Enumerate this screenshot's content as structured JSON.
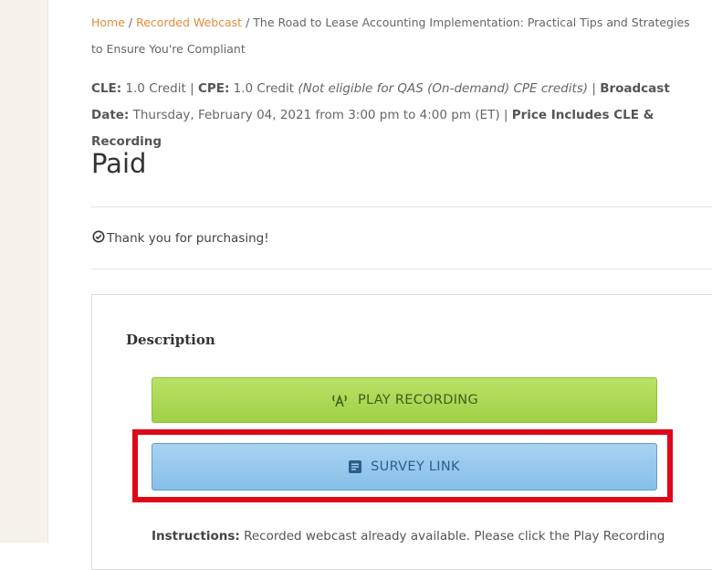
{
  "breadcrumb": {
    "home": "Home",
    "separator": " / ",
    "section": "Recorded Webcast",
    "current": "The Road to Lease Accounting Implementation: Practical Tips and Strategies to Ensure You're Compliant"
  },
  "meta": {
    "cle_label": "CLE:",
    "cle_value": " 1.0 Credit | ",
    "cpe_label": "CPE:",
    "cpe_value": " 1.0 Credit ",
    "cpe_note": "(Not eligible for QAS (On-demand) CPE credits)",
    "pipe": " | ",
    "broadcast_label": "Broadcast Date:",
    "broadcast_value": " Thursday, February 04, 2021 from 3:00 pm to 4:00 pm (ET) | ",
    "price_note": "Price Includes CLE & Recording"
  },
  "status": {
    "title": "Paid"
  },
  "purchase": {
    "message": "Thank you for purchasing!",
    "icon": "check-circle-icon"
  },
  "description": {
    "heading": "Description",
    "play_button": {
      "label": "PLAY RECORDING",
      "icon": "broadcast-icon"
    },
    "survey_button": {
      "label": "SURVEY LINK",
      "icon": "form-icon"
    },
    "instructions_label": "Instructions:",
    "instructions_text": " Recorded webcast already available. Please click the Play Recording"
  },
  "colors": {
    "link": "#e08d3c",
    "play_button_bg": "#a9d752",
    "survey_button_bg": "#95c8ee",
    "highlight_border": "#e0061a"
  }
}
